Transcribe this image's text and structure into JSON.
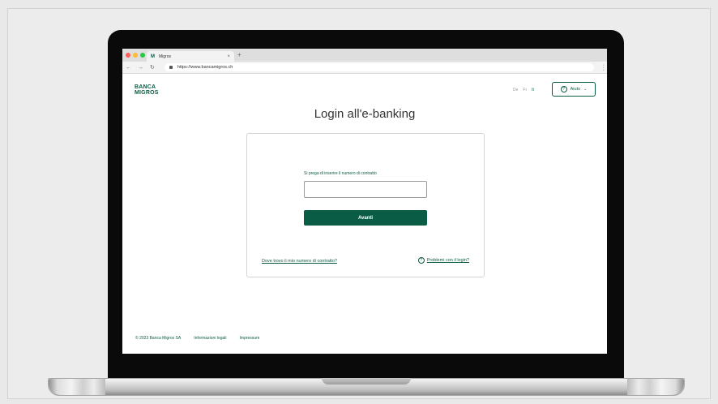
{
  "browser": {
    "tab_title": "Migros",
    "tab_favicon": "M",
    "tab_close": "×",
    "new_tab": "+",
    "url": "https://www.bancamigros.ch",
    "traffic_lights": [
      "#fe5f57",
      "#febc2e",
      "#28c840"
    ]
  },
  "header": {
    "logo_line1": "BANCA",
    "logo_line2": "MIGROS",
    "languages": [
      "De",
      "Fr",
      "It"
    ],
    "active_language": "It",
    "help_label": "Aiuto"
  },
  "login": {
    "title": "Login all'e-banking",
    "field_label": "Si prega di inserire il numero di contratto",
    "contract_value": "",
    "submit_label": "Avanti",
    "where_link": "Dove trovo il mio numero di contratto?",
    "problems_link": "Problemi con il login?"
  },
  "footer": {
    "copyright": "© 2023 Banca Migros SA",
    "legal": "Informazioni legali",
    "imprint": "Impressum"
  },
  "colors": {
    "brand": "#0b5c44"
  }
}
